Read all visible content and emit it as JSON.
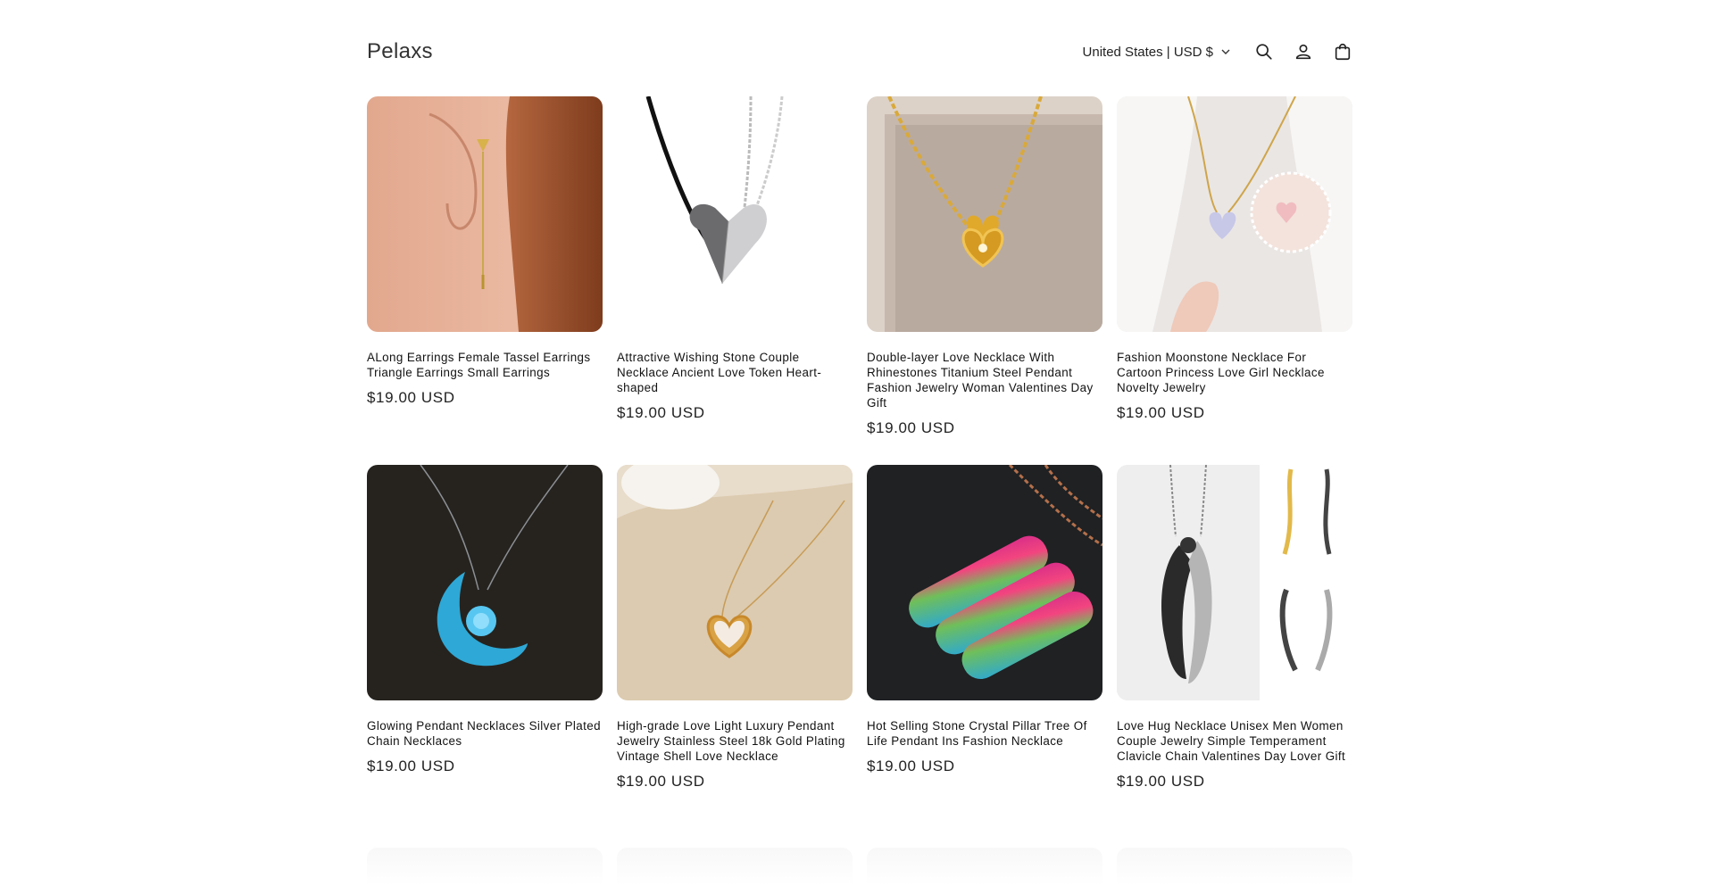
{
  "header": {
    "logo": "Pelaxs",
    "country_selector": "United States | USD $"
  },
  "products": [
    {
      "title": "ALong Earrings Female Tassel Earrings Triangle Earrings Small Earrings",
      "price": "$19.00 USD"
    },
    {
      "title": "Attractive Wishing Stone Couple Necklace Ancient Love Token Heart-shaped",
      "price": "$19.00 USD"
    },
    {
      "title": "Double-layer Love Necklace With Rhinestones Titanium Steel Pendant Fashion Jewelry Woman Valentines Day Gift",
      "price": "$19.00 USD"
    },
    {
      "title": "Fashion Moonstone Necklace For Cartoon Princess Love Girl Necklace Novelty Jewelry",
      "price": "$19.00 USD"
    },
    {
      "title": "Glowing Pendant Necklaces Silver Plated Chain Necklaces",
      "price": "$19.00 USD"
    },
    {
      "title": "High-grade Love Light Luxury Pendant Jewelry Stainless Steel 18k Gold Plating Vintage Shell Love Necklace",
      "price": "$19.00 USD"
    },
    {
      "title": "Hot Selling Stone Crystal Pillar Tree Of Life Pendant Ins Fashion Necklace",
      "price": "$19.00 USD"
    },
    {
      "title": "Love Hug Necklace Unisex Men Women Couple Jewelry Simple Temperament Clavicle Chain Valentines Day Lover Gift",
      "price": "$19.00 USD"
    }
  ],
  "icons": [
    "chevron-down-icon",
    "search-icon",
    "account-icon",
    "cart-icon"
  ]
}
